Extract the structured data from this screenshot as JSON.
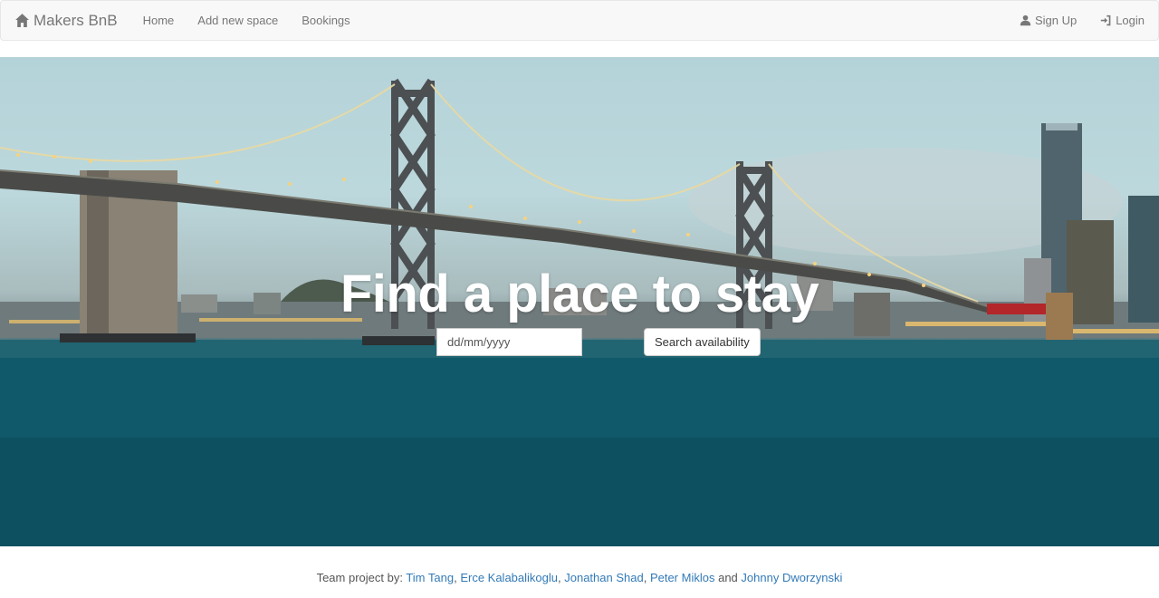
{
  "navbar": {
    "brand": "Makers BnB",
    "links": [
      "Home",
      "Add new space",
      "Bookings"
    ],
    "signup": "Sign Up",
    "login": "Login"
  },
  "hero": {
    "title": "Find a place to stay",
    "date_placeholder": "dd/mm/yyyy",
    "search_button": "Search availability"
  },
  "footer": {
    "prefix": "Team project by:",
    "members": [
      "Tim Tang",
      "Erce Kalabalikoglu",
      "Jonathan Shad",
      "Peter Miklos",
      "Johnny Dworzynski"
    ],
    "and": "and"
  },
  "colors": {
    "navbar_bg": "#f8f8f8",
    "link": "#337ab7",
    "water": "#0f5a6a"
  }
}
